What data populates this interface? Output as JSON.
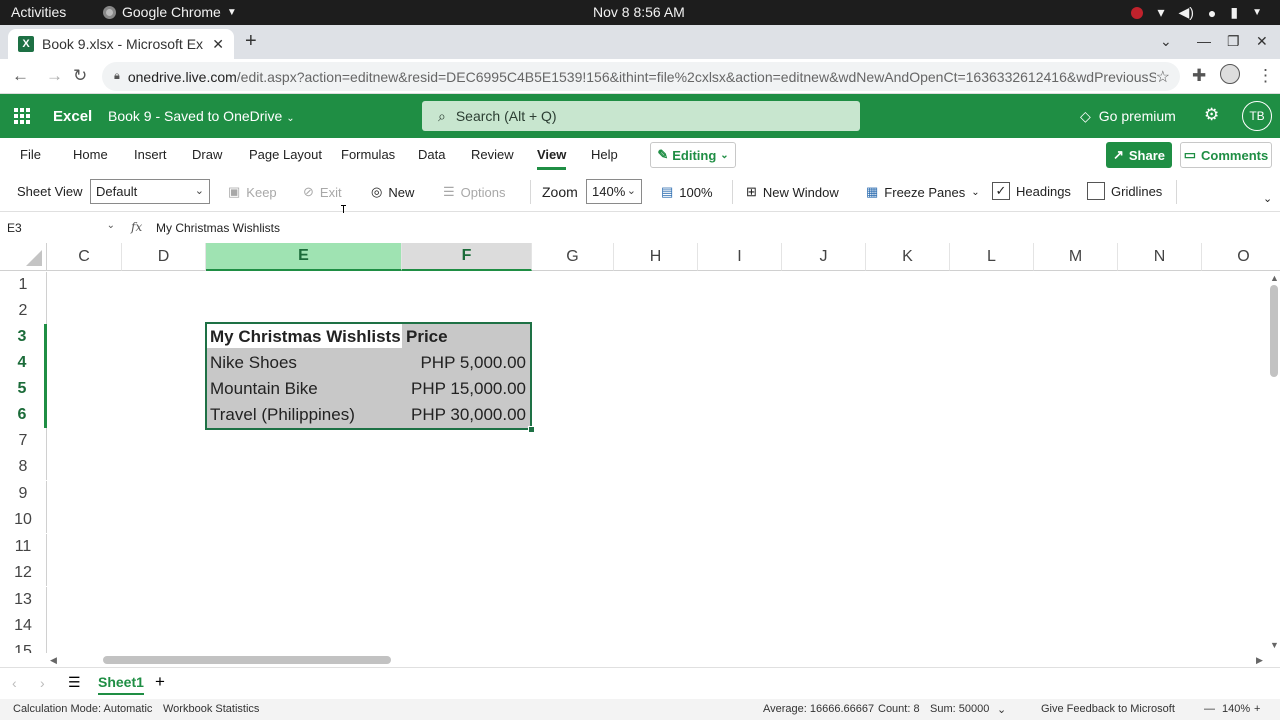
{
  "gnome": {
    "activities": "Activities",
    "app_name": "Google Chrome",
    "clock": "Nov 8   8:56 AM"
  },
  "browser": {
    "tab_title": "Book 9.xlsx - Microsoft Ex",
    "url_host": "onedrive.live.com",
    "url_rest": "/edit.aspx?action=editnew&resid=DEC6995C4B5E1539!156&ithint=file%2cxlsx&action=editnew&wdNewAndOpenCt=1636332612416&wdPreviousS..."
  },
  "excel_header": {
    "brand": "Excel",
    "doc_name": "Book 9  -  Saved to OneDrive",
    "search_placeholder": "Search (Alt + Q)",
    "premium": "Go premium",
    "avatar": "TB"
  },
  "ribbon": {
    "tabs": [
      "File",
      "Home",
      "Insert",
      "Draw",
      "Page Layout",
      "Formulas",
      "Data",
      "Review",
      "View",
      "Help"
    ],
    "active_tab": "View",
    "editing": "Editing",
    "share": "Share",
    "comments": "Comments",
    "commands": {
      "sheet_view_label": "Sheet View",
      "sheet_view_value": "Default",
      "keep": "Keep",
      "exit": "Exit",
      "new": "New",
      "options": "Options",
      "zoom_label": "Zoom",
      "zoom_value": "140%",
      "zoom_100": "100%",
      "new_window": "New Window",
      "freeze_panes": "Freeze Panes",
      "headings": "Headings",
      "gridlines": "Gridlines"
    }
  },
  "formula_bar": {
    "name_box": "E3",
    "fx": "fx",
    "content": "My Christmas Wishlists"
  },
  "grid": {
    "columns": [
      "C",
      "D",
      "E",
      "F",
      "G",
      "H",
      "I",
      "J",
      "K",
      "L",
      "M",
      "N",
      "O"
    ],
    "rows": [
      "1",
      "2",
      "3",
      "4",
      "5",
      "6",
      "7",
      "8",
      "9",
      "10",
      "11",
      "12",
      "13",
      "14",
      "15"
    ],
    "table": {
      "header": [
        "My Christmas Wishlists",
        "Price"
      ],
      "rows": [
        [
          "Nike Shoes",
          "PHP 5,000.00"
        ],
        [
          "Mountain Bike",
          "PHP 15,000.00"
        ],
        [
          "Travel (Philippines)",
          "PHP 30,000.00"
        ]
      ]
    }
  },
  "sheets": {
    "active": "Sheet1"
  },
  "status": {
    "calc_mode": "Calculation Mode: Automatic",
    "workbook_stats": "Workbook Statistics",
    "average": "Average: 16666.66667",
    "count": "Count: 8",
    "sum": "Sum: 50000",
    "feedback": "Give Feedback to Microsoft",
    "zoom": "140%"
  },
  "colors": {
    "excel_green": "#1f8e44",
    "selection_dark": "#1e7145",
    "header_selected": "#9fe3b2"
  }
}
